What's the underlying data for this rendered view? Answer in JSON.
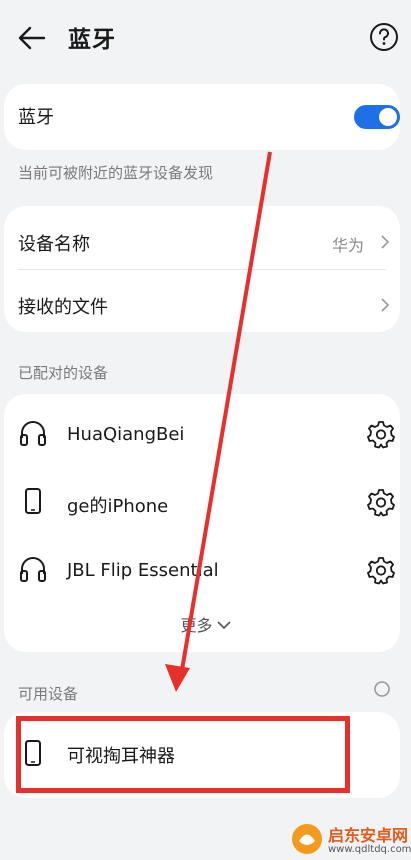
{
  "header": {
    "title": "蓝牙"
  },
  "bluetooth": {
    "label": "蓝牙",
    "enabled": true
  },
  "discoverable_note": "当前可被附近的蓝牙设备发现",
  "device_settings": {
    "name_label": "设备名称",
    "name_value": "华为",
    "received_files_label": "接收的文件"
  },
  "paired": {
    "section_label": "已配对的设备",
    "devices": [
      {
        "name": "HuaQiangBei",
        "icon": "headphones-icon"
      },
      {
        "name": "ge的iPhone",
        "icon": "phone-icon"
      },
      {
        "name": "JBL Flip Essential",
        "icon": "headphones-icon"
      }
    ],
    "more_label": "更多"
  },
  "available": {
    "section_label": "可用设备",
    "devices": [
      {
        "name": "可视掏耳神器",
        "icon": "phone-icon"
      }
    ]
  },
  "colors": {
    "accent": "#1e6fe8",
    "annotation": "#e7302c"
  },
  "watermark": {
    "name": "启东安卓网",
    "url": "www.qdltdq.com"
  }
}
